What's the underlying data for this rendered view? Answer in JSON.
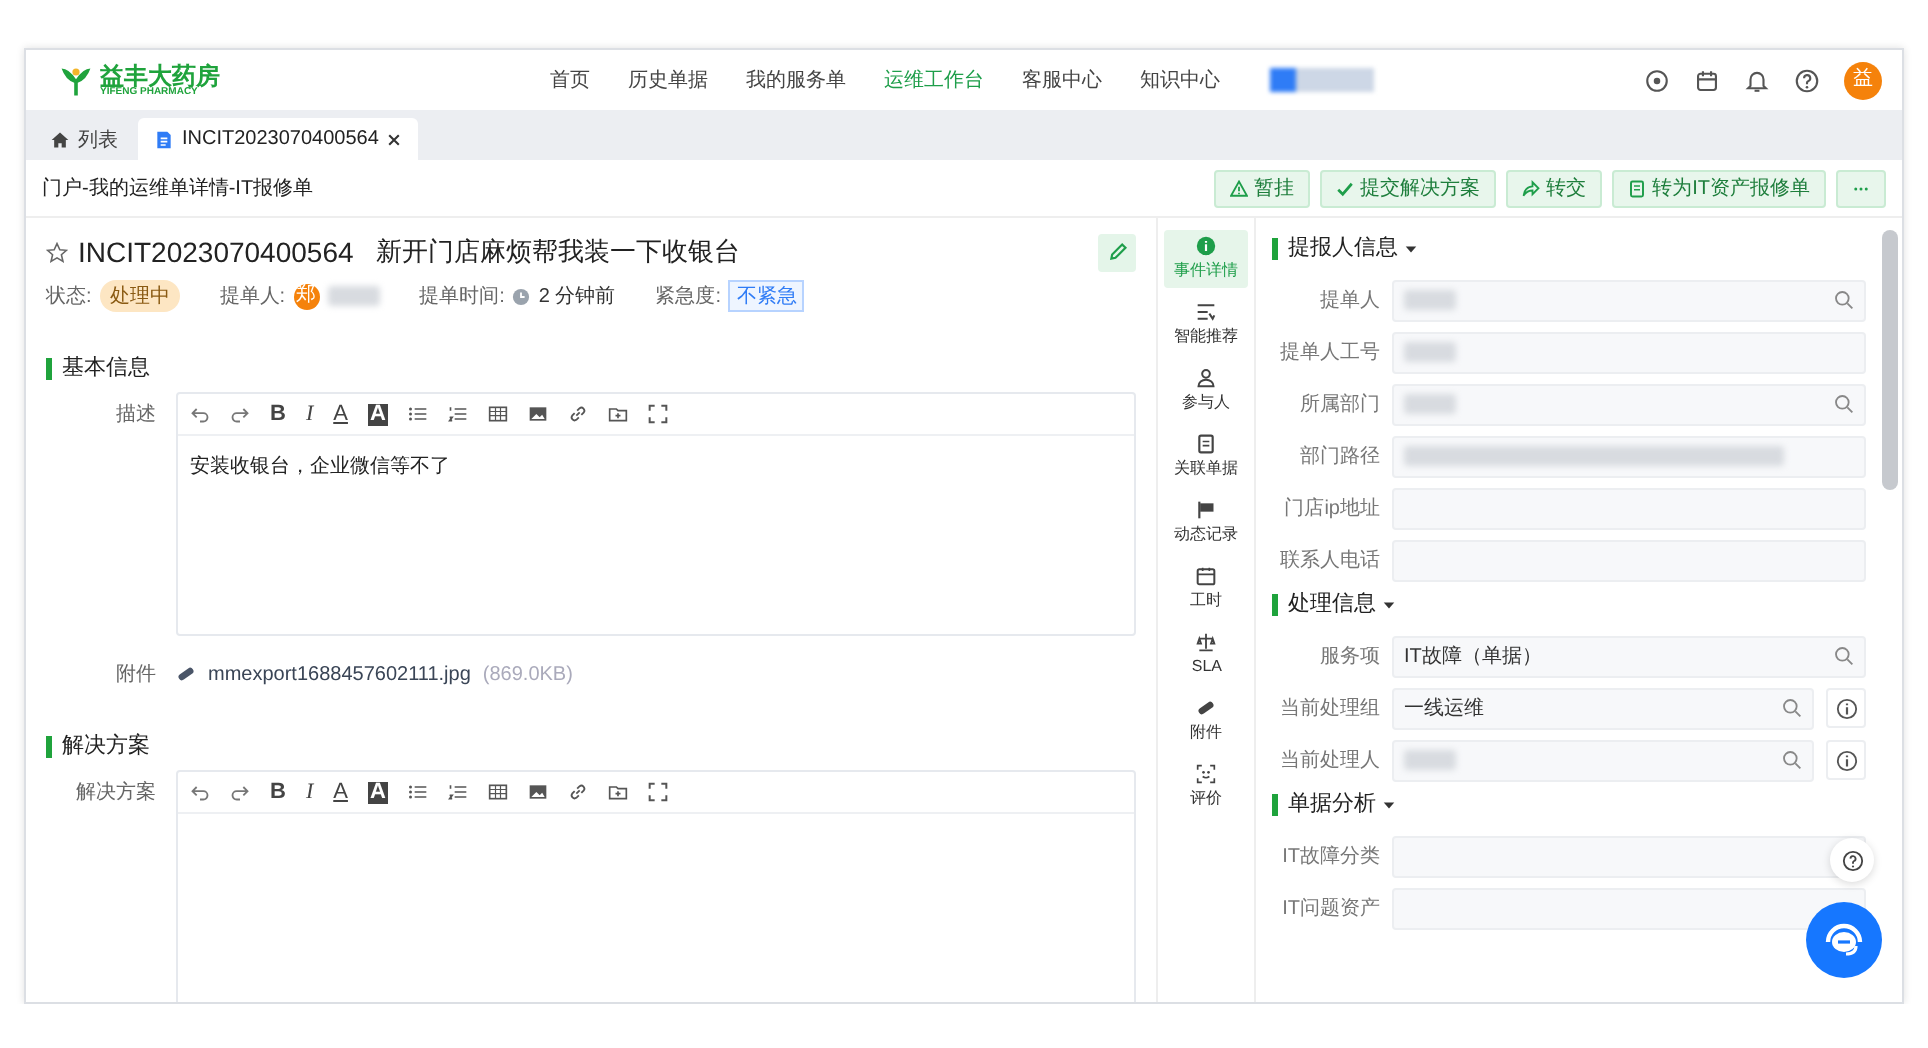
{
  "header": {
    "logo_name": "益丰大药房",
    "logo_sub": "YIFENG PHARMACY",
    "user_avatar": "益",
    "nav": [
      {
        "label": "首页",
        "selected": false
      },
      {
        "label": "历史单据",
        "selected": false
      },
      {
        "label": "我的服务单",
        "selected": false
      },
      {
        "label": "运维工作台",
        "selected": true
      },
      {
        "label": "客服中心",
        "selected": false
      },
      {
        "label": "知识中心",
        "selected": false
      }
    ]
  },
  "tabs": [
    {
      "label": "列表",
      "kind": "home",
      "selected": false,
      "closable": false
    },
    {
      "label": "INCIT2023070400564",
      "kind": "doc",
      "selected": true,
      "closable": true
    }
  ],
  "breadcrumb": "门户-我的运维单详情-IT报修单",
  "actions": [
    {
      "label": "暂挂",
      "kind": "warning"
    },
    {
      "label": "提交解决方案",
      "kind": "check"
    },
    {
      "label": "转交",
      "kind": "share"
    },
    {
      "label": "转为IT资产报修单",
      "kind": "doc"
    },
    {
      "kind": "more"
    }
  ],
  "ticket": {
    "starred": false,
    "number": "INCIT2023070400564",
    "title": "新开门店麻烦帮我装一下收银台",
    "status_label": "状态:",
    "status": "处理中",
    "submitter_label": "提单人:",
    "submitter_avatar": "郑",
    "submit_time_label": "提单时间:",
    "submit_time": "2 分钟前",
    "urgency_label": "紧急度:",
    "urgency": "不紧急"
  },
  "sections": [
    {
      "title": "基本信息",
      "fields": [
        {
          "label": "描述",
          "kind": "editor",
          "value": "安装收银台，企业微信等不了",
          "toolbar": [
            {
              "kind": "undo"
            },
            {
              "kind": "redo"
            },
            {
              "kind": "bold",
              "text": "B"
            },
            {
              "kind": "italic",
              "text": "I"
            },
            {
              "kind": "color",
              "text": "A"
            },
            {
              "kind": "highlight",
              "text": "A"
            },
            {
              "kind": "bullets"
            },
            {
              "kind": "numbers"
            },
            {
              "kind": "table"
            },
            {
              "kind": "image"
            },
            {
              "kind": "link"
            },
            {
              "kind": "upload"
            },
            {
              "kind": "fullscreen"
            }
          ]
        },
        {
          "label": "附件",
          "kind": "attachment",
          "file": "mmexport1688457602111.jpg",
          "size": "(869.0KB)"
        }
      ]
    },
    {
      "title": "解决方案",
      "fields": [
        {
          "label": "解决方案",
          "kind": "editor",
          "toolbar": [
            {
              "kind": "undo"
            },
            {
              "kind": "redo"
            },
            {
              "kind": "bold",
              "text": "B"
            },
            {
              "kind": "italic",
              "text": "I"
            },
            {
              "kind": "color",
              "text": "A"
            },
            {
              "kind": "highlight",
              "text": "A"
            },
            {
              "kind": "bullets"
            },
            {
              "kind": "numbers"
            },
            {
              "kind": "table"
            },
            {
              "kind": "image"
            },
            {
              "kind": "link"
            },
            {
              "kind": "upload"
            },
            {
              "kind": "fullscreen"
            }
          ]
        }
      ]
    }
  ],
  "side_nav": [
    {
      "label": "事件详情",
      "kind": "info",
      "selected": true
    },
    {
      "label": "智能推荐",
      "kind": "list",
      "selected": false
    },
    {
      "label": "参与人",
      "kind": "person",
      "selected": false
    },
    {
      "label": "关联单据",
      "kind": "doc",
      "selected": false
    },
    {
      "label": "动态记录",
      "kind": "flag",
      "selected": false
    },
    {
      "label": "工时",
      "kind": "calendar",
      "selected": false
    },
    {
      "label": "SLA",
      "kind": "scale",
      "selected": false
    },
    {
      "label": "附件",
      "kind": "clip",
      "selected": false
    },
    {
      "label": "评价",
      "kind": "face",
      "selected": false
    }
  ],
  "groups": [
    {
      "title": "提报人信息",
      "expanded": true,
      "fields": [
        {
          "label": "提单人",
          "kind": "search",
          "redacted": true
        },
        {
          "label": "提单人工号",
          "kind": "plain",
          "redacted": true
        },
        {
          "label": "所属部门",
          "kind": "search",
          "redacted": true
        },
        {
          "label": "部门路径",
          "kind": "plain",
          "redacted": true
        },
        {
          "label": "门店ip地址",
          "kind": "plain",
          "redacted": false
        },
        {
          "label": "联系人电话",
          "kind": "plain",
          "redacted": false
        }
      ]
    },
    {
      "title": "处理信息",
      "expanded": true,
      "fields": [
        {
          "label": "服务项",
          "kind": "search",
          "value": "IT故障（单据）",
          "redacted": false
        },
        {
          "label": "当前处理组",
          "kind": "search-info",
          "value": "一线运维",
          "redacted": false
        },
        {
          "label": "当前处理人",
          "kind": "search-info",
          "redacted": true
        }
      ]
    },
    {
      "title": "单据分析",
      "expanded": true,
      "fields": [
        {
          "label": "IT故障分类",
          "kind": "plain",
          "redacted": false
        },
        {
          "label": "IT问题资产",
          "kind": "plain",
          "redacted": false
        }
      ]
    }
  ]
}
